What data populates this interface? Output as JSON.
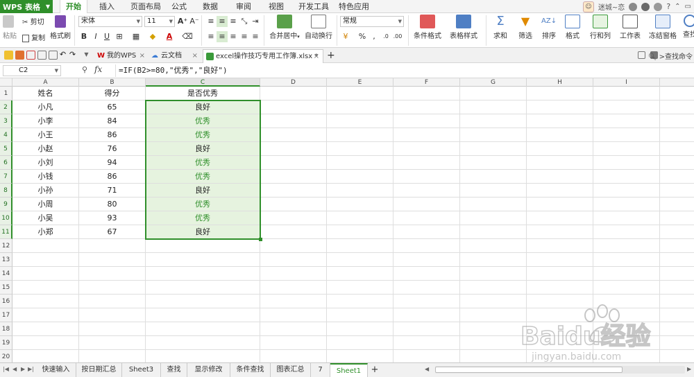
{
  "app": {
    "menu_button": "WPS 表格",
    "tabs": [
      "开始",
      "插入",
      "页面布局",
      "公式",
      "数据",
      "审阅",
      "视图",
      "开发工具",
      "特色应用"
    ],
    "active_tab": "开始",
    "user": "迷城~恋"
  },
  "ribbon": {
    "paste": "粘贴",
    "cut": "剪切",
    "copy": "复制",
    "format_painter": "格式刷",
    "font_name": "宋体",
    "font_size": "11",
    "merge_center": "合并居中",
    "wrap_text": "自动换行",
    "number_format": "常规",
    "percent": "%",
    "cond_format": "条件格式",
    "table_style": "表格样式",
    "sum": "求和",
    "filter": "筛选",
    "sort": "排序",
    "format": "格式",
    "row_col": "行和列",
    "worksheet": "工作表",
    "freeze": "冻结窗格",
    "find": "查找"
  },
  "doc_tabs": {
    "items": [
      {
        "label": "我的WPS"
      },
      {
        "label": "云文档"
      },
      {
        "label": "excel操作技巧专用工作簿.xlsx *"
      }
    ],
    "add": "+",
    "search": "查找命令"
  },
  "formula_bar": {
    "cell_ref": "C2",
    "fx": "fx",
    "formula": "=IF(B2>=80,\"优秀\",\"良好\")"
  },
  "grid": {
    "columns": [
      "A",
      "B",
      "C",
      "D",
      "E",
      "F",
      "G",
      "H",
      "I"
    ],
    "rows": [
      "1",
      "2",
      "3",
      "4",
      "5",
      "6",
      "7",
      "8",
      "9",
      "10",
      "11",
      "12",
      "13",
      "14",
      "15",
      "16",
      "17",
      "18",
      "19",
      "20"
    ],
    "data": [
      [
        "姓名",
        "得分",
        "是否优秀"
      ],
      [
        "小凡",
        "65",
        "良好"
      ],
      [
        "小李",
        "84",
        "优秀"
      ],
      [
        "小王",
        "86",
        "优秀"
      ],
      [
        "小赵",
        "76",
        "良好"
      ],
      [
        "小刘",
        "94",
        "优秀"
      ],
      [
        "小钱",
        "86",
        "优秀"
      ],
      [
        "小孙",
        "71",
        "良好"
      ],
      [
        "小周",
        "80",
        "优秀"
      ],
      [
        "小吴",
        "93",
        "优秀"
      ],
      [
        "小郑",
        "67",
        "良好"
      ]
    ]
  },
  "sheets": {
    "items": [
      "快速输入",
      "按日期汇总",
      "Sheet3",
      "查找",
      "显示修改",
      "条件查找",
      "图表汇总",
      "7",
      "Sheet1"
    ],
    "active": "Sheet1",
    "add": "+"
  },
  "watermark": {
    "text": "Baidu经验",
    "url": "jingyan.baidu.com"
  }
}
